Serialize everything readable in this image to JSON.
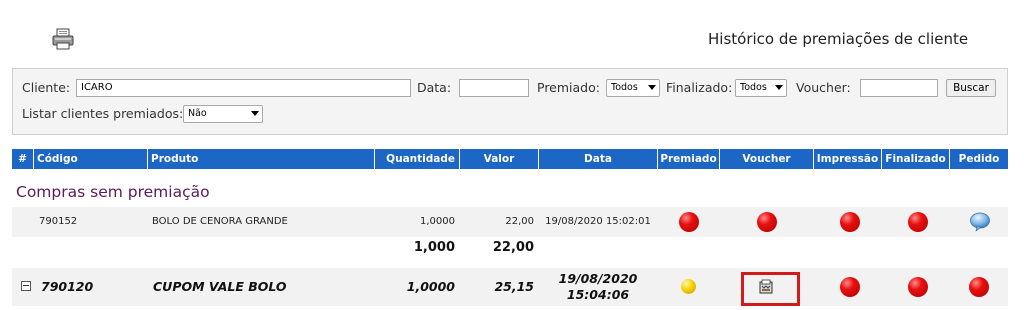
{
  "header": {
    "printer_icon": "printer-icon",
    "title": "Histórico de premiações de cliente"
  },
  "filters": {
    "cliente_label": "Cliente:",
    "cliente_value": "ICARO",
    "data_label": "Data:",
    "data_value": "",
    "premiado_label": "Premiado:",
    "premiado_value": "Todos",
    "finalizado_label": "Finalizado:",
    "finalizado_value": "Todos",
    "voucher_label": "Voucher:",
    "voucher_value": "",
    "buscar_label": "Buscar",
    "listar_label": "Listar clientes premiados:",
    "listar_value": "Não"
  },
  "table": {
    "columns": [
      "#",
      "Código",
      "Produto",
      "Quantidade",
      "Valor",
      "Data",
      "Premiado",
      "Voucher",
      "Impressão",
      "Finalizado",
      "Pedido"
    ],
    "header_color": "#1c66c6"
  },
  "section": {
    "title": "Compras sem premiação"
  },
  "rows": [
    {
      "codigo": "790152",
      "produto": "BOLO DE CENORA GRANDE",
      "quantidade": "1,0000",
      "valor": "22,00",
      "data": "19/08/2020 15:02:01",
      "premiado": "red",
      "voucher": "red",
      "impressao": "red",
      "finalizado": "red",
      "pedido": "speech-bubble-icon"
    }
  ],
  "totals": {
    "quantidade": "1,000",
    "valor": "22,00"
  },
  "group_row": {
    "toggle": "⊟",
    "codigo": "790120",
    "produto": "CUPOM VALE BOLO",
    "quantidade": "1,0000",
    "valor": "25,15",
    "data_date": "19/08/2020",
    "data_time": "15:04:06",
    "premiado": "yellow",
    "voucher": "voucher-icon",
    "impressao": "red",
    "finalizado": "red",
    "pedido": "red",
    "highlight_color": "#d11a1a"
  }
}
